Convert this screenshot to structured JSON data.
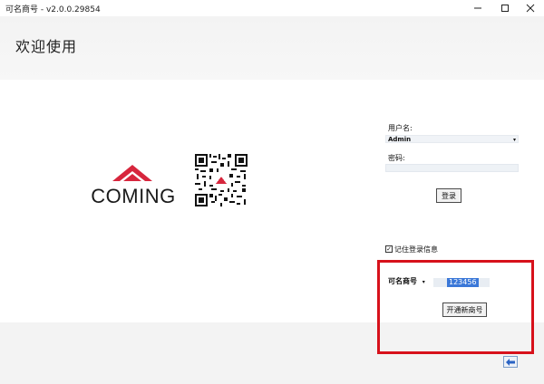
{
  "window": {
    "title": "可名商号 - v2.0.0.29854",
    "controls": [
      "minimize-icon",
      "maximize-icon",
      "close-icon"
    ]
  },
  "header": {
    "welcome": "欢迎使用"
  },
  "branding": {
    "logo_text": "COMING",
    "logo_color": "#d7263d"
  },
  "login": {
    "username_label": "用户名:",
    "username_value": "Admin",
    "password_label": "密码:",
    "password_value": "",
    "login_button": "登录",
    "remember_label": "记住登录信息",
    "remember_checked": true
  },
  "open_account": {
    "type_selected": "可名商号",
    "number_value": "123456",
    "open_button": "开通新商号"
  },
  "colors": {
    "highlight": "#d7111b",
    "selection": "#3b78d8"
  }
}
